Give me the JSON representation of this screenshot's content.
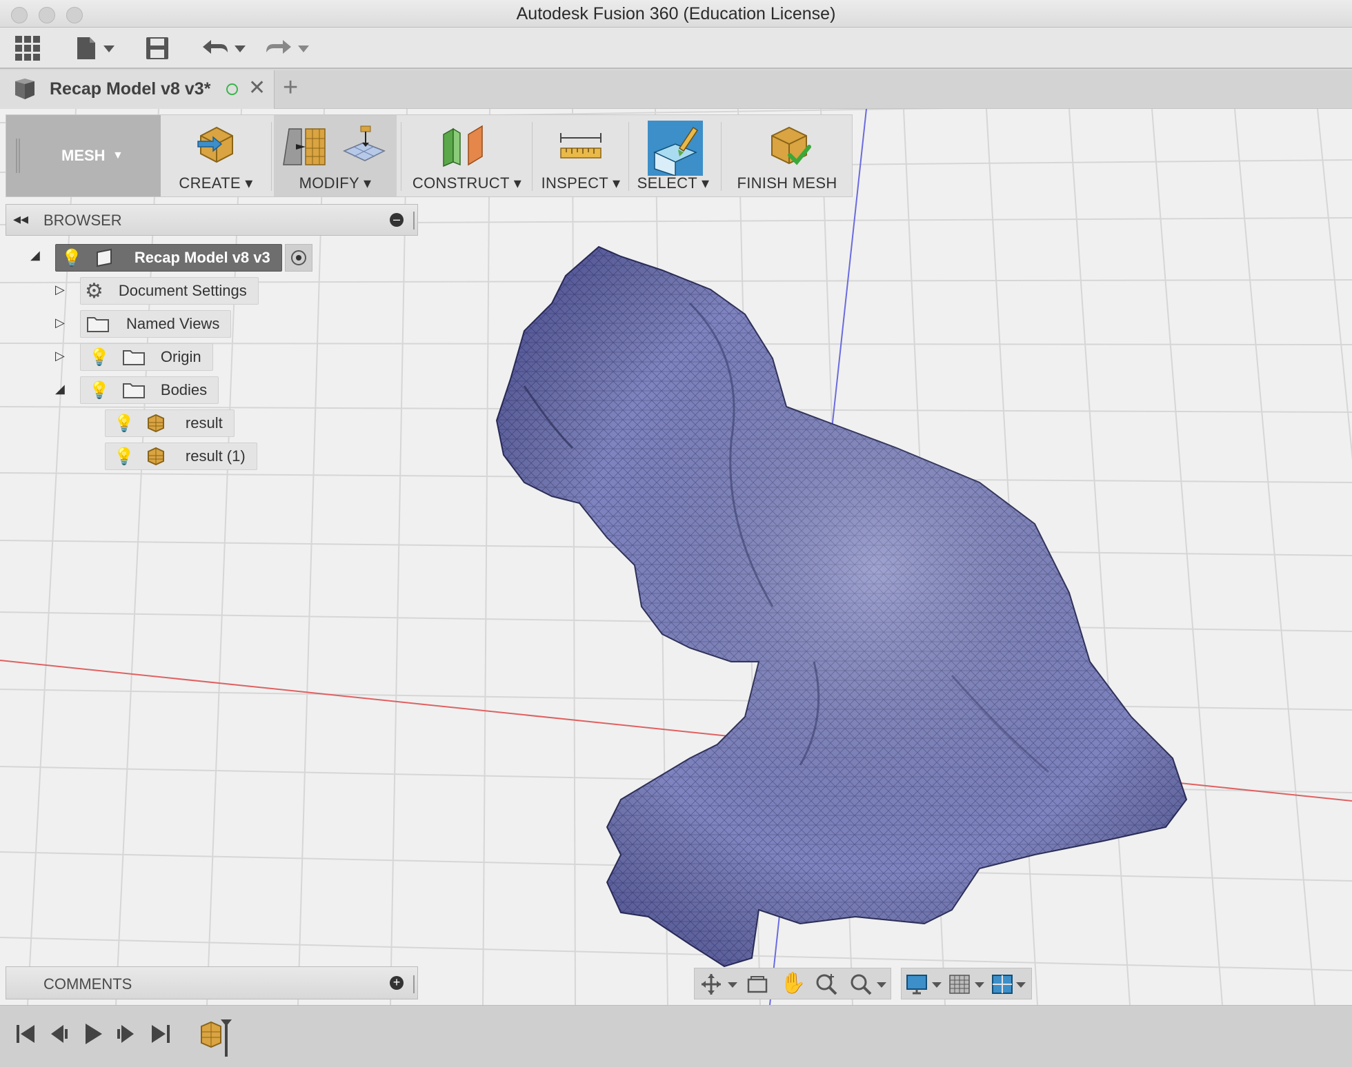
{
  "window": {
    "title": "Autodesk Fusion 360 (Education License)"
  },
  "document_tab": {
    "title": "Recap Model v8 v3*"
  },
  "ribbon": {
    "workspace": "MESH",
    "groups": {
      "create": "CREATE",
      "modify": "MODIFY",
      "construct": "CONSTRUCT",
      "inspect": "INSPECT",
      "select": "SELECT",
      "finish": "FINISH MESH"
    }
  },
  "browser": {
    "header": "BROWSER",
    "root": "Recap Model v8 v3",
    "items": {
      "document_settings": "Document Settings",
      "named_views": "Named Views",
      "origin": "Origin",
      "bodies": "Bodies",
      "result": "result",
      "result1": "result (1)"
    }
  },
  "comments": {
    "header": "COMMENTS"
  },
  "colors": {
    "mesh": "#7f84c0",
    "grid": "#d8d8d8",
    "x_axis": "#e06060",
    "z_axis": "#6a6ae0",
    "accent_select": "#3c8fc9"
  }
}
